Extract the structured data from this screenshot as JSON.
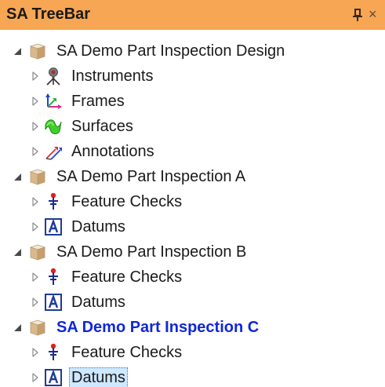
{
  "panel": {
    "title": "SA TreeBar",
    "pin_icon": "pin-icon",
    "close_glyph": "×"
  },
  "colors": {
    "titlebar_bg": "#f7a654",
    "active_label": "#1028d8",
    "selection_bg": "#cde8ff"
  },
  "tree": {
    "rows": [
      {
        "level": 0,
        "expanded": true,
        "icon": "part-icon",
        "label": "SA Demo Part Inspection Design"
      },
      {
        "level": 1,
        "expanded": false,
        "icon": "instruments-icon",
        "label": "Instruments"
      },
      {
        "level": 1,
        "expanded": false,
        "icon": "frames-icon",
        "label": "Frames"
      },
      {
        "level": 1,
        "expanded": false,
        "icon": "surfaces-icon",
        "label": "Surfaces"
      },
      {
        "level": 1,
        "expanded": false,
        "icon": "annotations-icon",
        "label": "Annotations"
      },
      {
        "level": 0,
        "expanded": true,
        "icon": "part-icon",
        "label": "SA Demo Part Inspection A"
      },
      {
        "level": 1,
        "expanded": false,
        "icon": "feature-checks-icon",
        "label": "Feature Checks"
      },
      {
        "level": 1,
        "expanded": false,
        "icon": "datums-icon",
        "label": "Datums"
      },
      {
        "level": 0,
        "expanded": true,
        "icon": "part-icon",
        "label": "SA Demo Part Inspection B"
      },
      {
        "level": 1,
        "expanded": false,
        "icon": "feature-checks-icon",
        "label": "Feature Checks"
      },
      {
        "level": 1,
        "expanded": false,
        "icon": "datums-icon",
        "label": "Datums"
      },
      {
        "level": 0,
        "expanded": true,
        "icon": "part-icon",
        "label": "SA Demo Part Inspection C",
        "active": true
      },
      {
        "level": 1,
        "expanded": false,
        "icon": "feature-checks-icon",
        "label": "Feature Checks"
      },
      {
        "level": 1,
        "expanded": false,
        "icon": "datums-icon",
        "label": "Datums",
        "selected": true
      }
    ]
  }
}
